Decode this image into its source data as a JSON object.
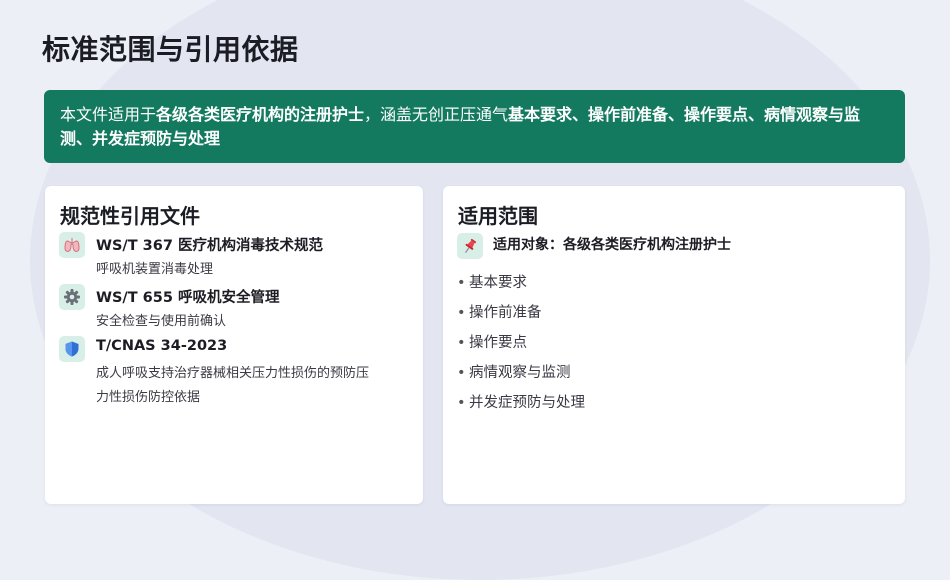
{
  "title": "标准范围与引用依据",
  "banner": {
    "t1": "本文件适用于",
    "b1": "各级各类医疗机构的注册护士",
    "t2": "，涵盖无创正压通气",
    "b2": "基本要求、操作前准备、操作要点、病情观察与监测、并发症预防与处理"
  },
  "left": {
    "title": "规范性引用文件",
    "refs": [
      {
        "icon": "lung-icon",
        "code": "WS/T 367  医疗机构消毒技术规范",
        "desc": "呼吸机装置消毒处理"
      },
      {
        "icon": "gear-icon",
        "code": "WS/T 655  呼吸机安全管理",
        "desc": "安全检查与使用前确认"
      },
      {
        "icon": "shield-icon",
        "code": "T/CNAS 34-2023",
        "desc": "成人呼吸支持治疗器械相关压力性损伤的预防压力性损伤防控依据"
      }
    ]
  },
  "right": {
    "title": "适用范围",
    "target_icon": "pushpin-icon",
    "target": "适用对象：各级各类医疗机构注册护士",
    "bullet": "•",
    "items": [
      "基本要求",
      "操作前准备",
      "操作要点",
      "病情观察与监测",
      "并发症预防与处理"
    ]
  },
  "colors": {
    "accent": "#137a60",
    "icon_bg": "#d8efe8"
  }
}
